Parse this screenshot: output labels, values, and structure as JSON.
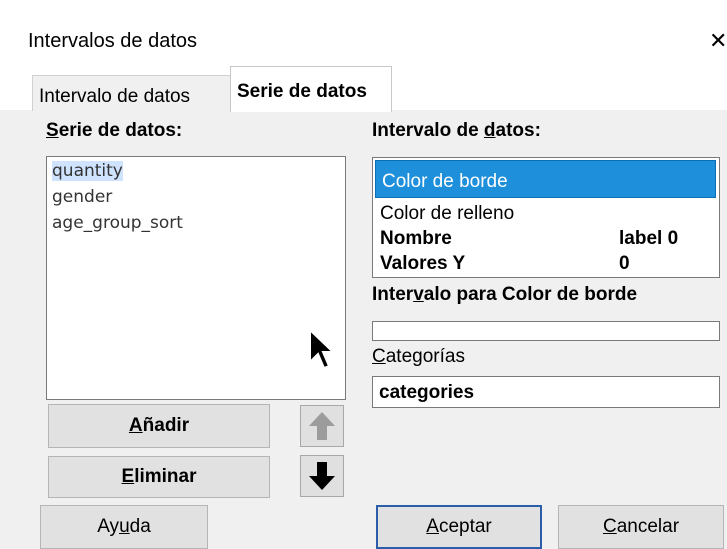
{
  "window": {
    "title": "Intervalos de datos",
    "close_glyph": "✕"
  },
  "tabs": [
    {
      "label": "Intervalo de datos",
      "active": false
    },
    {
      "label": "Serie de datos",
      "active": true
    }
  ],
  "series_panel": {
    "label_pre": "",
    "label_mnemonic": "S",
    "label_post": "erie de datos:",
    "items": [
      "quantity",
      "gender",
      "age_group_sort"
    ],
    "selected_index": 0
  },
  "buttons": {
    "add": {
      "mnemonic": "A",
      "rest": "ñadir"
    },
    "remove": {
      "mnemonic": "E",
      "rest": "liminar"
    },
    "help": {
      "pre": "Ay",
      "mnemonic": "u",
      "post": "da"
    },
    "ok": {
      "mnemonic": "A",
      "rest": "ceptar"
    },
    "cancel": {
      "mnemonic": "C",
      "rest": "ancelar"
    }
  },
  "range_panel": {
    "label_pre": "Intervalo de ",
    "label_mnemonic": "d",
    "label_post": "atos:",
    "selected": "Color de borde",
    "rows": [
      {
        "name": "Color de relleno",
        "value": ""
      },
      {
        "name": "Nombre",
        "value": "label 0"
      },
      {
        "name": "Valores Y",
        "value": "0"
      }
    ]
  },
  "range_for": {
    "pre": "Inter",
    "mnemonic": "v",
    "post": "alo para Color de borde",
    "value": ""
  },
  "categories": {
    "mnemonic": "C",
    "post": "ategorías",
    "value": "categories"
  },
  "colors": {
    "selection": "#1e8fdb",
    "focus_border": "#2a5ea8"
  }
}
